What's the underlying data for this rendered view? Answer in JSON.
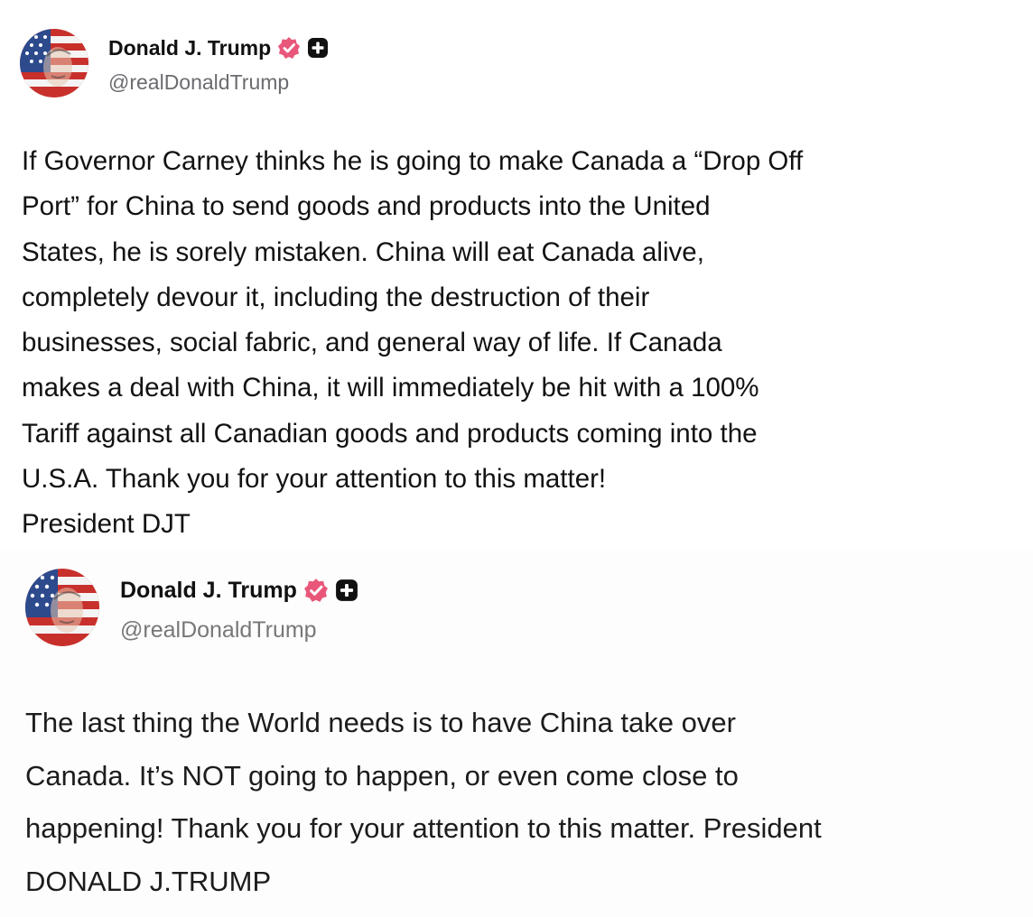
{
  "colors": {
    "verified_badge": "#e8577a",
    "plus_badge": "#111111",
    "handle_text": "#6b6b70",
    "body_text": "#121212",
    "background": "#ffffff"
  },
  "posts": [
    {
      "author": {
        "display_name": "Donald J. Trump",
        "handle": "@realDonaldTrump",
        "avatar_icon": "flag-portrait-avatar",
        "badges": [
          "verified-badge-icon",
          "plus-badge-icon"
        ]
      },
      "text": "If Governor Carney thinks he is going to make Canada a “Drop Off\nPort” for China to send goods and products into the United\nStates, he is sorely mistaken. China will eat Canada alive,\ncompletely devour it, including the destruction of their\nbusinesses, social fabric, and general way of life. If Canada\nmakes a  deal with China, it will immediately be hit with a 100%\nTariff against all Canadian goods and products coming into the\nU.S.A. Thank you for your attention to this matter!\nPresident DJT"
    },
    {
      "author": {
        "display_name": "Donald J. Trump",
        "handle": "@realDonaldTrump",
        "avatar_icon": "flag-portrait-avatar",
        "badges": [
          "verified-badge-icon",
          "plus-badge-icon"
        ]
      },
      "text": "The last thing the World needs is to have China take over\nCanada. It’s NOT going to happen, or even come close to\nhappening! Thank you for your attention to this matter. President\nDONALD J.TRUMP"
    }
  ]
}
